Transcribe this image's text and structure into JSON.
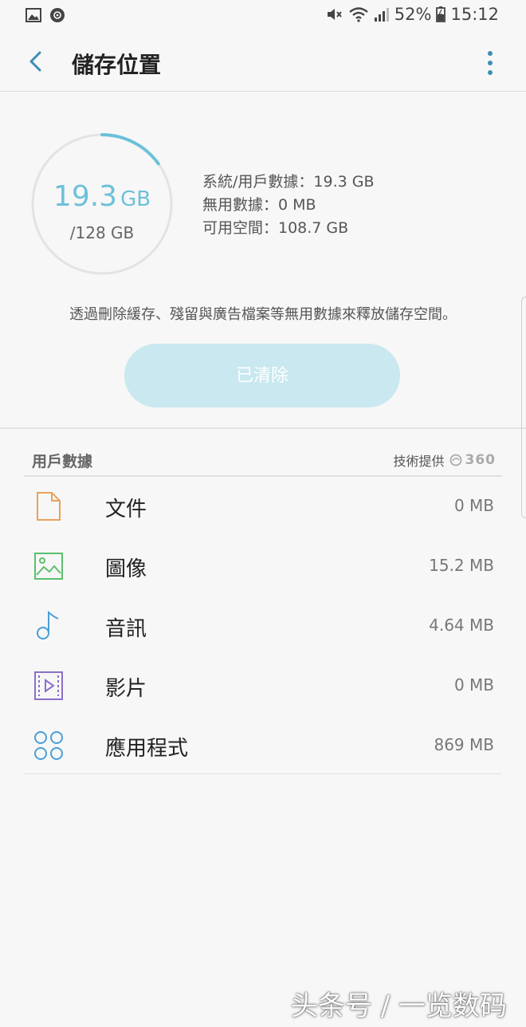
{
  "status_bar": {
    "battery": "52%",
    "time": "15:12"
  },
  "header": {
    "title": "儲存位置"
  },
  "storage": {
    "used_value": "19.3",
    "used_unit": "GB",
    "total": "/128 GB",
    "used_fraction": 0.151,
    "system_user_data": "系統/用戶數據：19.3 GB",
    "junk_data": "無用數據：0 MB",
    "available_space": "可用空間：108.7 GB",
    "description": "透過刪除緩存、殘留與廣告檔案等無用數據來釋放儲存空間。",
    "clean_button": "已清除"
  },
  "user_data": {
    "title": "用戶數據",
    "provider_label": "技術提供",
    "provider_logo": "360",
    "items": [
      {
        "label": "文件",
        "size": "0 MB",
        "icon": "document-icon",
        "color": "#e9a15a"
      },
      {
        "label": "圖像",
        "size": "15.2 MB",
        "icon": "image-icon",
        "color": "#5cbf6d"
      },
      {
        "label": "音訊",
        "size": "4.64 MB",
        "icon": "music-note-icon",
        "color": "#4a9fd8"
      },
      {
        "label": "影片",
        "size": "0 MB",
        "icon": "video-icon",
        "color": "#8b6fc9"
      },
      {
        "label": "應用程式",
        "size": "869 MB",
        "icon": "apps-icon",
        "color": "#4a9fd8"
      }
    ]
  },
  "watermark": "头条号 / 一览数码",
  "colors": {
    "accent": "#6cc1d8",
    "button_bg": "#c9e8ef",
    "back_arrow": "#3a8fb5"
  }
}
